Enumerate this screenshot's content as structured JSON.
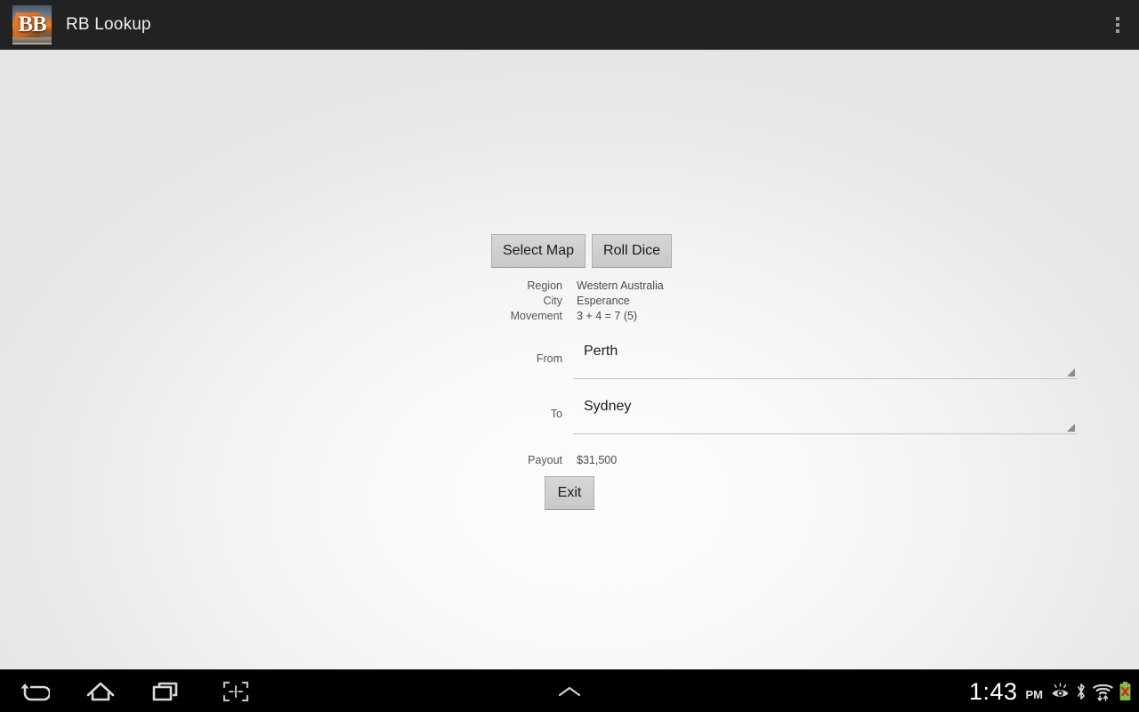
{
  "action_bar": {
    "title": "RB Lookup",
    "app_icon_letters": "BB",
    "app_icon_name": "train-locomotive-app-icon",
    "overflow_icon": "overflow-menu-icon"
  },
  "form": {
    "buttons": {
      "select_map": "Select Map",
      "roll_dice": "Roll Dice",
      "exit": "Exit"
    },
    "info": [
      {
        "label": "Region",
        "value": "Western Australia"
      },
      {
        "label": "City",
        "value": "Esperance"
      },
      {
        "label": "Movement",
        "value": "3 + 4 = 7 (5)"
      }
    ],
    "from": {
      "label": "From",
      "value": "Perth",
      "dropdown_icon": "spinner-triangle-icon"
    },
    "to": {
      "label": "To",
      "value": "Sydney",
      "dropdown_icon": "spinner-triangle-icon"
    },
    "payout": {
      "label": "Payout",
      "value": "$31,500"
    }
  },
  "nav_bar": {
    "back_icon": "back-arrow-icon",
    "home_icon": "home-icon",
    "recent_icon": "recent-apps-icon",
    "screenshot_icon": "screenshot-capture-icon",
    "chevron_icon": "chevron-up-icon",
    "clock_time": "1:43",
    "clock_ampm": "PM",
    "status_icons": [
      "eye-care-icon",
      "bluetooth-icon",
      "wifi-transfer-icon",
      "battery-error-icon"
    ]
  },
  "colors": {
    "action_bar_bg": "#222222",
    "nav_bar_bg": "#000000",
    "content_bg": "#e8e8e8",
    "button_bg": "#cfcfcf",
    "battery_green": "#7ac043",
    "battery_red": "#e02020"
  }
}
